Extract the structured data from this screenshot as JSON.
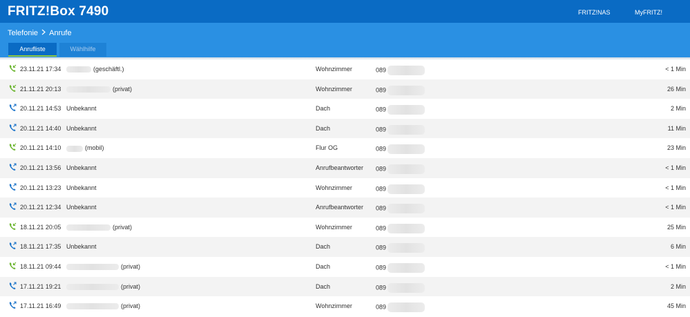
{
  "header": {
    "title": "FRITZ!Box 7490",
    "links": [
      "FRITZ!NAS",
      "MyFRITZ!"
    ]
  },
  "breadcrumb": {
    "parent": "Telefonie",
    "current": "Anrufe"
  },
  "tabs": [
    {
      "label": "Anrufliste",
      "active": true
    },
    {
      "label": "Wählhilfe",
      "active": false
    }
  ],
  "colors": {
    "incoming": "#6ab42d",
    "outgoing": "#1a73c9"
  },
  "calls": [
    {
      "type": "incoming",
      "icon": "incoming-call-icon",
      "datetime": "23.11.21 17:34",
      "name_suffix": "(geschäftl.)",
      "port": "Wohnzimmer",
      "number_prefix": "089",
      "duration": "< 1 Min"
    },
    {
      "type": "incoming",
      "icon": "incoming-call-icon",
      "datetime": "21.11.21 20:13",
      "name_suffix": "(privat)",
      "port": "Wohnzimmer",
      "number_prefix": "089",
      "duration": "26 Min"
    },
    {
      "type": "outgoing",
      "icon": "outgoing-call-icon",
      "datetime": "20.11.21 14:53",
      "name": "Unbekannt",
      "port": "Dach",
      "number_prefix": "089",
      "duration": "2 Min"
    },
    {
      "type": "outgoing",
      "icon": "outgoing-call-icon",
      "datetime": "20.11.21 14:40",
      "name": "Unbekannt",
      "port": "Dach",
      "number_prefix": "089",
      "duration": "11 Min"
    },
    {
      "type": "incoming",
      "icon": "incoming-call-icon",
      "datetime": "20.11.21 14:10",
      "name_suffix": "(mobil)",
      "port": "Flur OG",
      "number_prefix": "089",
      "duration": "23 Min"
    },
    {
      "type": "outgoing",
      "icon": "outgoing-call-icon",
      "datetime": "20.11.21 13:56",
      "name": "Unbekannt",
      "port": "Anrufbeantworter",
      "number_prefix": "089",
      "duration": "< 1 Min"
    },
    {
      "type": "outgoing",
      "icon": "outgoing-call-icon",
      "datetime": "20.11.21 13:23",
      "name": "Unbekannt",
      "port": "Wohnzimmer",
      "number_prefix": "089",
      "duration": "< 1 Min"
    },
    {
      "type": "outgoing",
      "icon": "outgoing-call-icon",
      "datetime": "20.11.21 12:34",
      "name": "Unbekannt",
      "port": "Anrufbeantworter",
      "number_prefix": "089",
      "duration": "< 1 Min"
    },
    {
      "type": "incoming",
      "icon": "incoming-call-icon",
      "datetime": "18.11.21 20:05",
      "name_suffix": "(privat)",
      "port": "Wohnzimmer",
      "number_prefix": "089",
      "duration": "25 Min"
    },
    {
      "type": "outgoing",
      "icon": "outgoing-call-icon",
      "datetime": "18.11.21 17:35",
      "name": "Unbekannt",
      "port": "Dach",
      "number_prefix": "089",
      "duration": "6 Min"
    },
    {
      "type": "incoming",
      "icon": "incoming-call-icon",
      "datetime": "18.11.21 09:44",
      "name_suffix": "(privat)",
      "port": "Dach",
      "number_prefix": "089",
      "duration": "< 1 Min"
    },
    {
      "type": "outgoing",
      "icon": "outgoing-call-icon",
      "datetime": "17.11.21 19:21",
      "name_suffix": "(privat)",
      "port": "Dach",
      "number_prefix": "089",
      "duration": "2 Min"
    },
    {
      "type": "outgoing",
      "icon": "outgoing-call-icon",
      "datetime": "17.11.21 16:49",
      "name_suffix": "(privat)",
      "port": "Wohnzimmer",
      "number_prefix": "089",
      "duration": "45 Min"
    }
  ]
}
